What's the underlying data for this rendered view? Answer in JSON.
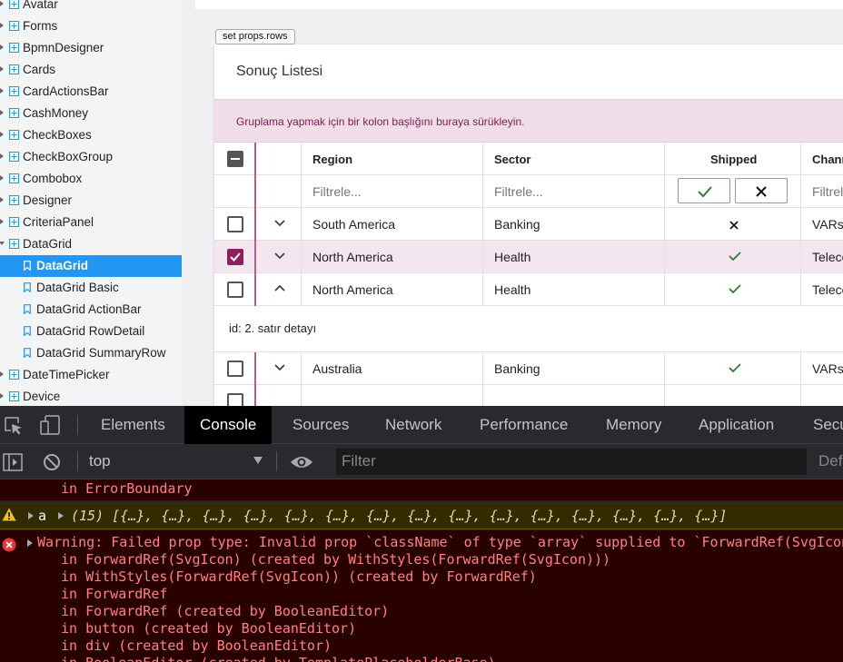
{
  "sidebar": {
    "items": [
      {
        "label": "Avatar",
        "type": "group"
      },
      {
        "label": "Forms",
        "type": "group"
      },
      {
        "label": "BpmnDesigner",
        "type": "group"
      },
      {
        "label": "Cards",
        "type": "group"
      },
      {
        "label": "CardActionsBar",
        "type": "group"
      },
      {
        "label": "CashMoney",
        "type": "group"
      },
      {
        "label": "CheckBoxes",
        "type": "group"
      },
      {
        "label": "CheckBoxGroup",
        "type": "group"
      },
      {
        "label": "Combobox",
        "type": "group"
      },
      {
        "label": "Designer",
        "type": "group"
      },
      {
        "label": "CriteriaPanel",
        "type": "group"
      },
      {
        "label": "DataGrid",
        "type": "group-open"
      },
      {
        "label": "DataGrid",
        "type": "child-selected"
      },
      {
        "label": "DataGrid Basic",
        "type": "child"
      },
      {
        "label": "DataGrid ActionBar",
        "type": "child"
      },
      {
        "label": "DataGrid RowDetail",
        "type": "child"
      },
      {
        "label": "DataGrid SummaryRow",
        "type": "child"
      },
      {
        "label": "DateTimePicker",
        "type": "group"
      },
      {
        "label": "Device",
        "type": "group"
      }
    ]
  },
  "main": {
    "set_rows_label": "set props.rows",
    "card_title": "Sonuç Listesi",
    "group_hint": "Gruplama yapmak için bir kolon başlığını buraya sürükleyin.",
    "columns": [
      "Region",
      "Sector",
      "Shipped",
      "Channel"
    ],
    "filter_placeholder": "Filtrele...",
    "rows": [
      {
        "region": "South America",
        "sector": "Banking",
        "shipped": false,
        "channel": "VARs",
        "checked": false,
        "expanded": false
      },
      {
        "region": "North America",
        "sector": "Health",
        "shipped": true,
        "channel": "Telecom",
        "checked": true,
        "expanded": false
      },
      {
        "region": "North America",
        "sector": "Health",
        "shipped": true,
        "channel": "Telecom",
        "checked": false,
        "expanded": true
      }
    ],
    "detail_text": "id: 2. satır detayı",
    "rows_after": [
      {
        "region": "Australia",
        "sector": "Banking",
        "shipped": true,
        "channel": "VARs",
        "checked": false,
        "expanded": false
      }
    ]
  },
  "devtools": {
    "tabs": [
      "Elements",
      "Console",
      "Sources",
      "Network",
      "Performance",
      "Memory",
      "Application",
      "Security"
    ],
    "active_tab": "Console",
    "context": "top",
    "filter_placeholder": "Filter",
    "levels_label": "Default levels",
    "console": {
      "prev_line": "in ErrorBoundary",
      "warn_var": "a",
      "warn_array": "(15) [{…}, {…}, {…}, {…}, {…}, {…}, {…}, {…}, {…}, {…}, {…}, {…}, {…}, {…}, {…}]",
      "error_message": "Warning: Failed prop type: Invalid prop `className` of type `array` supplied to `ForwardRef(SvgIcon)`",
      "stack": [
        "in ForwardRef(SvgIcon) (created by WithStyles(ForwardRef(SvgIcon)))",
        "in WithStyles(ForwardRef(SvgIcon)) (created by ForwardRef)",
        "in ForwardRef",
        "in ForwardRef (created by BooleanEditor)",
        "in button (created by BooleanEditor)",
        "in div (created by BooleanEditor)",
        "in BooleanEditor (created by TemplatePlaceholderBase)"
      ]
    }
  }
}
